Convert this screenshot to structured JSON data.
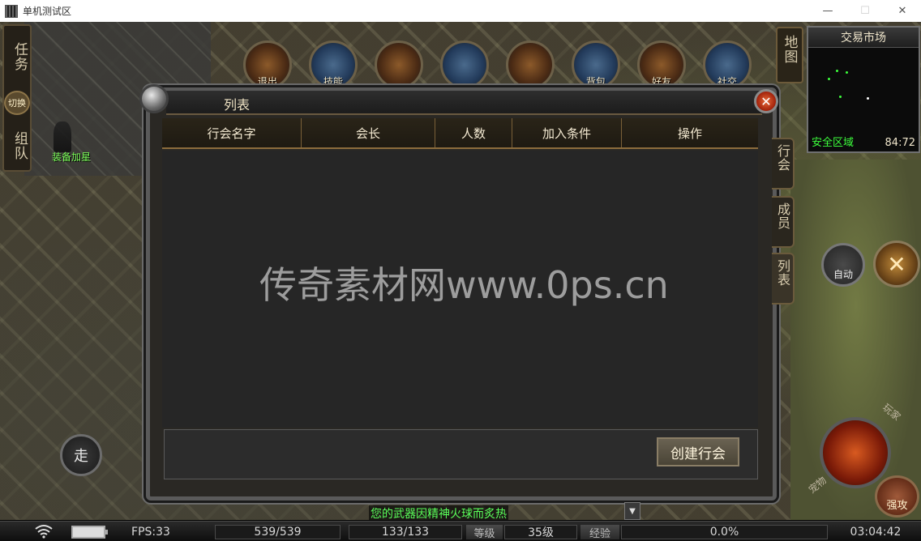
{
  "window": {
    "title": "单机测试区",
    "minimize": "—",
    "maximize": "☐",
    "close": "✕"
  },
  "left_tabs": {
    "task": "任务",
    "switch": "切换",
    "team": "组队"
  },
  "player_name": "装备加星",
  "walk": "走",
  "top_icons": [
    {
      "label": "退出",
      "icon": "exit-icon"
    },
    {
      "label": "技能",
      "icon": "skill-book-icon"
    },
    {
      "label": "",
      "icon": "banner-icon"
    },
    {
      "label": "",
      "icon": "mount-icon"
    },
    {
      "label": "",
      "icon": "armor-icon"
    },
    {
      "label": "背包",
      "icon": "bag-icon"
    },
    {
      "label": "好友",
      "icon": "friends-icon"
    },
    {
      "label": "社交",
      "icon": "social-icon"
    }
  ],
  "map_tab": "地图",
  "minimap": {
    "title": "交易市场",
    "zone": "安全区域",
    "coords": "84:72"
  },
  "right_buttons": {
    "auto": "自动",
    "player": "玩家",
    "pet": "宠物",
    "strong": "强攻"
  },
  "panel": {
    "title": "列表",
    "close": "✕",
    "columns": [
      "行会名字",
      "会长",
      "人数",
      "加入条件",
      "操作"
    ],
    "watermark": "传奇素材网www.0ps.cn",
    "create_button": "创建行会",
    "side_tabs": [
      "行会",
      "成员",
      "列表"
    ],
    "active_tab": "列表"
  },
  "chat": {
    "line": "您的武器因精神火球而炙热"
  },
  "status": {
    "fps": "FPS:33",
    "hp": "539/539",
    "mp": "133/133",
    "level_label": "等级",
    "level": "35级",
    "exp_label": "经验",
    "exp": "0.0%",
    "time": "03:04:42"
  },
  "colors": {
    "zone_green": "#3cff3c",
    "chat_green": "#5aff5a",
    "name_green": "#7cff5a",
    "close_red": "#c0301a"
  }
}
